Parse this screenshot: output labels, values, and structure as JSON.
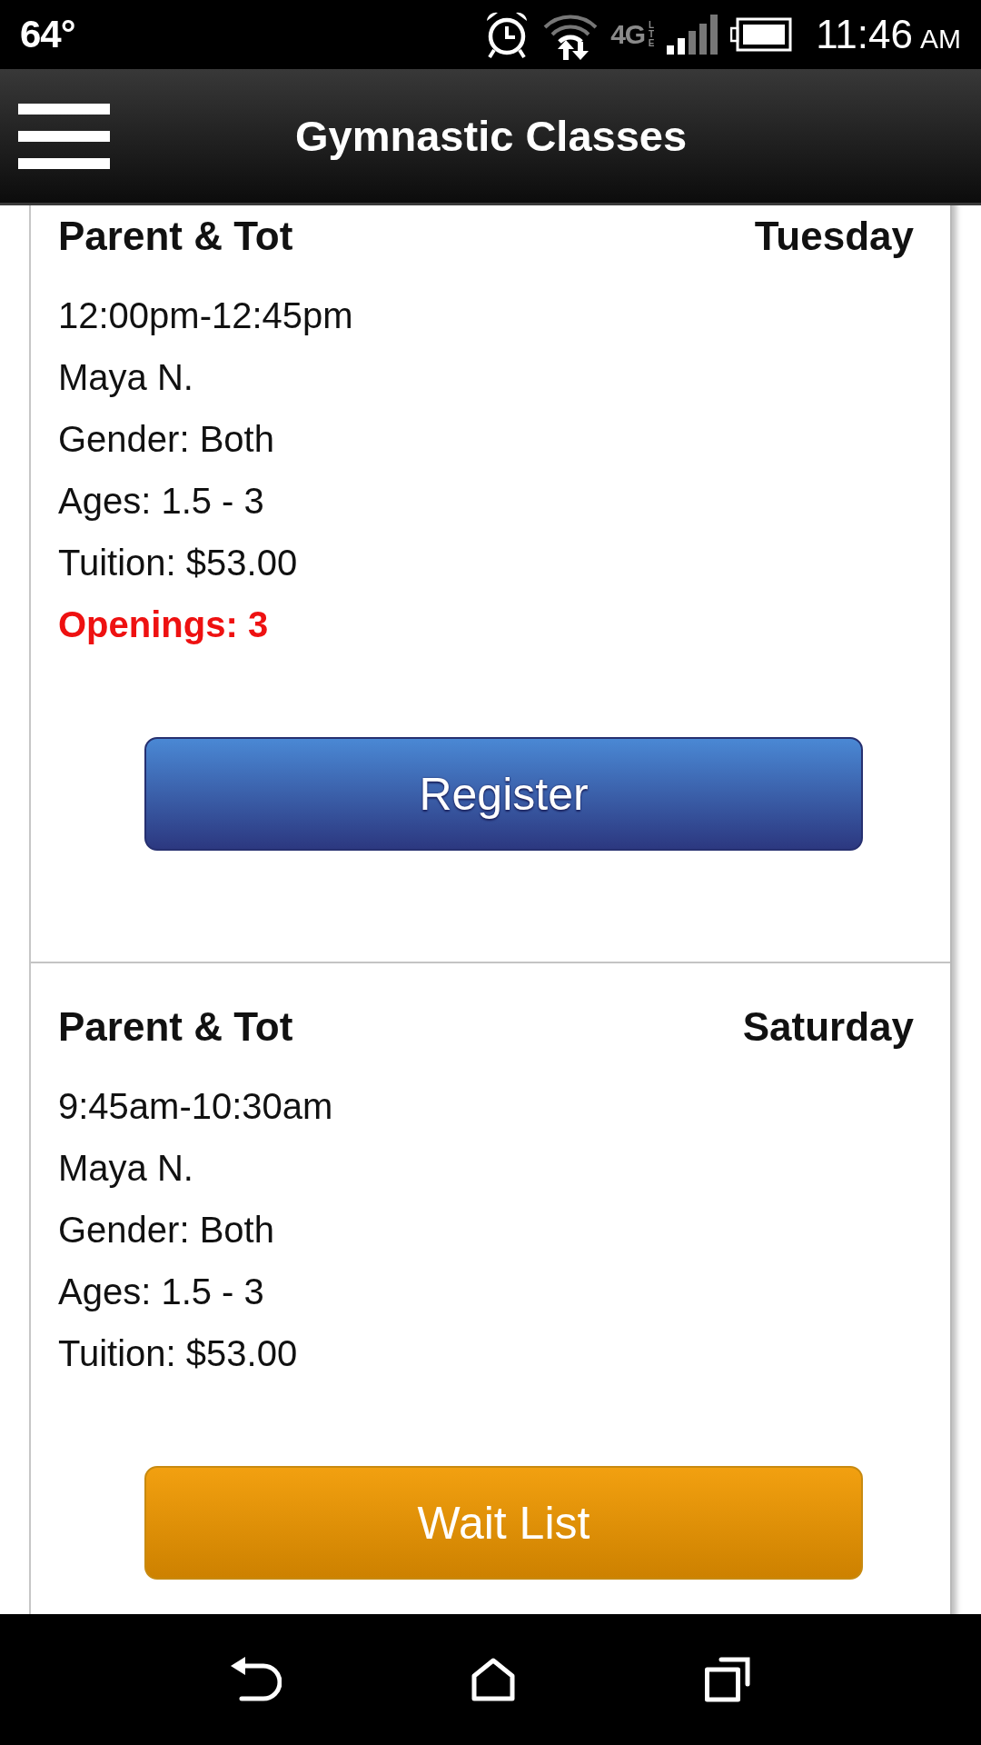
{
  "status_bar": {
    "temperature": "64°",
    "network": "4G",
    "network_sub": "LTE",
    "time": "11:46",
    "meridiem": "AM"
  },
  "header": {
    "title": "Gymnastic Classes"
  },
  "classes": [
    {
      "name": "Parent & Tot",
      "day": "Tuesday",
      "time": "12:00pm-12:45pm",
      "instructor": "Maya N.",
      "gender": "Gender: Both",
      "ages": "Ages: 1.5 - 3",
      "tuition": "Tuition: $53.00",
      "openings": "Openings: 3",
      "button": {
        "kind": "register",
        "label": "Register"
      }
    },
    {
      "name": "Parent & Tot",
      "day": "Saturday",
      "time": "9:45am-10:30am",
      "instructor": "Maya N.",
      "gender": "Gender: Both",
      "ages": "Ages: 1.5 - 3",
      "tuition": "Tuition: $53.00",
      "button": {
        "kind": "wait_list",
        "label": "Wait List"
      }
    }
  ]
}
